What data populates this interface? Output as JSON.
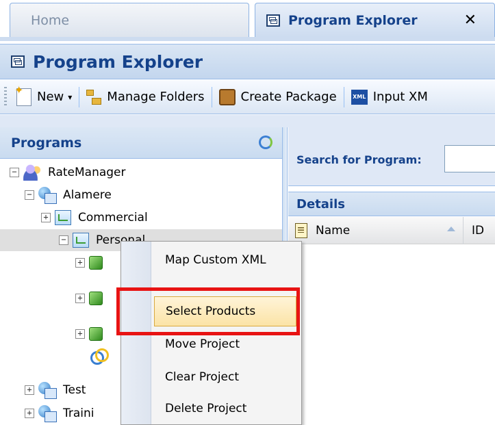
{
  "tabs": [
    {
      "label": "Home"
    },
    {
      "label": "Program Explorer",
      "close": "✕"
    }
  ],
  "panel": {
    "title": "Program Explorer"
  },
  "toolbar": {
    "new_label": "New",
    "new_caret": "▾",
    "manage_folders_label": "Manage Folders",
    "create_package_label": "Create Package",
    "input_xml_label": "Input XM",
    "xml_icon_text": "XML"
  },
  "programs": {
    "title": "Programs",
    "tree": [
      {
        "label": "RateManager",
        "expander": "−"
      },
      {
        "label": "Alamere",
        "expander": "−"
      },
      {
        "label": "Commercial",
        "expander": "+"
      },
      {
        "label": "Personal",
        "expander": "−"
      },
      {
        "label": "",
        "expander": "+"
      },
      {
        "label": "",
        "expander": "+"
      },
      {
        "label": "",
        "expander": "+"
      },
      {
        "label": ""
      },
      {
        "label": "Test",
        "expander": "+"
      },
      {
        "label": "Traini",
        "expander": "+"
      }
    ]
  },
  "search": {
    "label": "Search for Program:",
    "value": ""
  },
  "details": {
    "title": "Details",
    "columns": [
      {
        "label": "Name"
      },
      {
        "label": "ID"
      }
    ]
  },
  "context_menu": {
    "items": [
      {
        "label": "Map Custom XML"
      },
      {
        "label": "Select Products"
      },
      {
        "label": "Move Project"
      },
      {
        "label": "Clear Project"
      },
      {
        "label": "Delete Project"
      }
    ]
  },
  "colors": {
    "accent": "#15428b",
    "highlight_box": "#e81313",
    "menu_active": "#fbe3a6"
  }
}
